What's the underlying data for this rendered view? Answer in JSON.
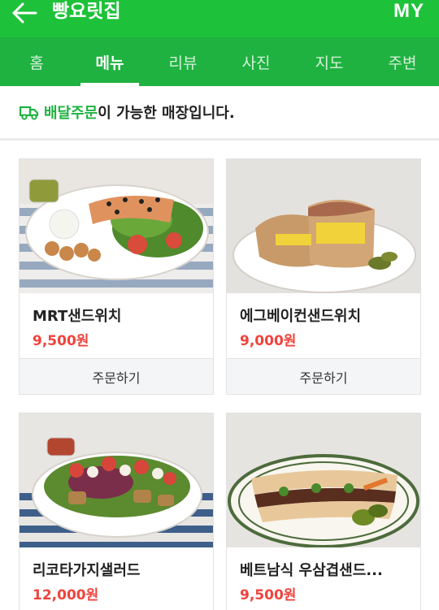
{
  "header": {
    "back_icon": "arrow-left-icon",
    "title": "빵요릿집",
    "my_label": "MY",
    "bar_color": "#1ec23a"
  },
  "tabs": [
    {
      "label": "홈"
    },
    {
      "label": "메뉴",
      "active": true
    },
    {
      "label": "리뷰"
    },
    {
      "label": "사진"
    },
    {
      "label": "지도"
    },
    {
      "label": "주변"
    }
  ],
  "notice": {
    "icon": "delivery-truck-icon",
    "highlight": "배달주문",
    "text": "이 가능한 매장입니다."
  },
  "menu": [
    {
      "name": "MRT샌드위치",
      "price": "9,500원",
      "order_label": "주문하기"
    },
    {
      "name": "에그베이컨샌드위치",
      "price": "9,000원",
      "order_label": "주문하기"
    },
    {
      "name": "리코타가지샐러드",
      "price": "12,000원"
    },
    {
      "name": "베트남식 우삼겹샌드...",
      "price": "9,500원"
    }
  ],
  "colors": {
    "accent": "#1fb240",
    "price": "#f0433c"
  }
}
